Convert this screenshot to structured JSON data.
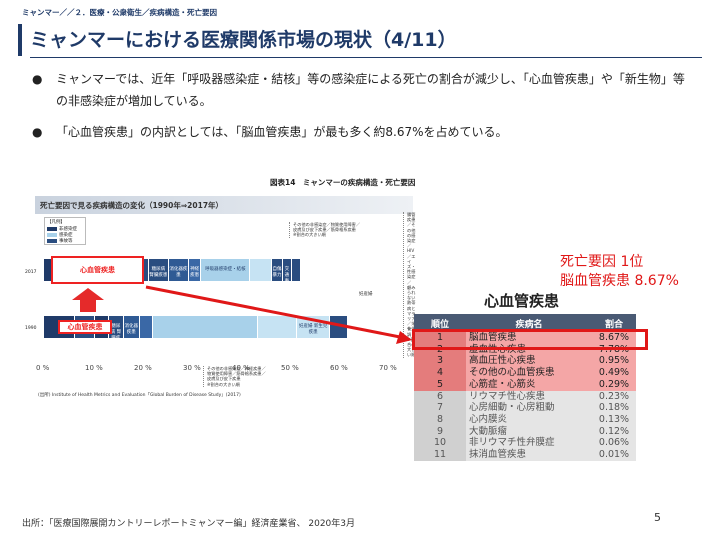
{
  "header": {
    "breadcrumb": "ミャンマー／／２．医療・公衆衛生／疾病構造・死亡要因",
    "title": "ミャンマーにおける医療関係市場の現状（4/11）"
  },
  "bullets": [
    "ミャンマーでは、近年「呼吸器感染症・結核」等の感染症による死亡の割合が減少し、「心血管疾患」や「新生物」等の非感染症が増加している。",
    "「心血管疾患」の内訳としては、「脳血管疾患」が最も多く約8.67%を占めている。"
  ],
  "bullet_symbol": "●",
  "figure": {
    "caption": "図表14　ミャンマーの疾病構造・死亡要因",
    "header": "死亡要因で見る疾病構造の変化（1990年⇒2017年）",
    "legend": {
      "title": "【凡例】",
      "items": [
        "非感染症",
        "感染症",
        "事故等"
      ]
    },
    "row_labels": {
      "y2017": "2017",
      "y1990": "1990"
    },
    "highlight_label": "心血管疾患",
    "segments_2017": [
      {
        "label": "",
        "share": 0.115,
        "color": "#1f3a68"
      },
      {
        "label": "新生物",
        "share": 0.075,
        "color": "#1f3a68"
      },
      {
        "label": "慢性呼吸器疾",
        "share": 0.1,
        "color": "#2a4d80"
      },
      {
        "label": "糖尿病 腎臓疾患",
        "share": 0.055,
        "color": "#2a4d80"
      },
      {
        "label": "消化器疾患",
        "share": 0.055,
        "color": "#2f5a94"
      },
      {
        "label": "神経疾患",
        "share": 0.035,
        "color": "#3a68a6"
      },
      {
        "label": "呼吸器感染症・結核",
        "share": 0.135,
        "color": "#a8d1ea"
      },
      {
        "label": "",
        "share": 0.06,
        "color": "#c6e3f3"
      },
      {
        "label": "自傷暴力",
        "share": 0.03,
        "color": "#2a4d80"
      },
      {
        "label": "交通事故",
        "share": 0.025,
        "color": "#2a4d80"
      },
      {
        "label": "",
        "share": 0.025,
        "color": "#2a4d80"
      }
    ],
    "segments_1990": [
      {
        "label": "",
        "share": 0.085,
        "color": "#1f3a68"
      },
      {
        "label": "慢性呼吸器疾",
        "share": 0.055,
        "color": "#2a4d80"
      },
      {
        "label": "新生物",
        "share": 0.04,
        "color": "#1f3a68"
      },
      {
        "label": "糖尿病 腎臓疾患",
        "share": 0.04,
        "color": "#2a4d80"
      },
      {
        "label": "消化器疾患",
        "share": 0.045,
        "color": "#2f5a94"
      },
      {
        "label": "",
        "share": 0.035,
        "color": "#3a68a6"
      },
      {
        "label": "",
        "share": 0.29,
        "color": "#a8d1ea"
      },
      {
        "label": "",
        "share": 0.11,
        "color": "#c6e3f3"
      },
      {
        "label": "妊産婦 新生児疾患",
        "share": 0.09,
        "color": "#c6e3f3"
      },
      {
        "label": "",
        "share": 0.05,
        "color": "#2a4d80"
      }
    ],
    "callout_top": [
      "腸管疾患／その他の感染症／",
      "HIV／エイズ・性感染症／",
      "顧みられない熱帯病とマラリア／栄養失調",
      "※割合の大きい順"
    ],
    "callout_top_left": [
      "その他の非感染症／物質使用障害／",
      "皮膚及び皮下疾患／筋骨格系疾患",
      "※割合の大きい順"
    ],
    "callout_bottom": [
      "その他の非感染症／神経疾患／",
      "物質使用障害／筋骨格系疾患／",
      "皮膚及び皮下疾患",
      "※割合の大きい順"
    ],
    "x_ticks": [
      "0 %",
      "10 %",
      "20 %",
      "30 %",
      "40 %",
      "50 %",
      "60 %",
      "70 %"
    ],
    "source": "(出所) Institute of Health Metrics and Evaluation「Global Burden of Disease Study」(2017)",
    "legend_note": "妊産婦"
  },
  "death_cause": {
    "line1": "死亡要因 1位",
    "line2": "脳血管疾患 8.67%"
  },
  "cv_table": {
    "title": "心血管疾患",
    "headers": [
      "順位",
      "疾病名",
      "割合"
    ],
    "rows": [
      {
        "rank": "1",
        "name": "脳血管疾患",
        "share": "8.67%",
        "style": "red"
      },
      {
        "rank": "2",
        "name": "虚血性心疾患",
        "share": "7.78%",
        "style": "red"
      },
      {
        "rank": "3",
        "name": "高血圧性心疾患",
        "share": "0.95%",
        "style": "red"
      },
      {
        "rank": "4",
        "name": "その他の心血管疾患",
        "share": "0.49%",
        "style": "red"
      },
      {
        "rank": "5",
        "name": "心筋症・心筋炎",
        "share": "0.29%",
        "style": "red"
      },
      {
        "rank": "6",
        "name": "リウマチ性心疾患",
        "share": "0.23%",
        "style": "gray"
      },
      {
        "rank": "7",
        "name": "心房細動・心房粗動",
        "share": "0.18%",
        "style": "gray"
      },
      {
        "rank": "8",
        "name": "心内膜炎",
        "share": "0.13%",
        "style": "gray"
      },
      {
        "rank": "9",
        "name": "大動脈瘤",
        "share": "0.12%",
        "style": "gray"
      },
      {
        "rank": "10",
        "name": "非リウマチ性弁膜症",
        "share": "0.06%",
        "style": "gray"
      },
      {
        "rank": "11",
        "name": "抹消血管疾患",
        "share": "0.01%",
        "style": "gray"
      }
    ]
  },
  "footer": {
    "source": "出所：「医療国際展開カントリーレポートミャンマー編」経済産業省、 2020年3月",
    "page": "5"
  },
  "colors": {
    "accent": "#1f3a68",
    "highlight": "#e01818"
  }
}
